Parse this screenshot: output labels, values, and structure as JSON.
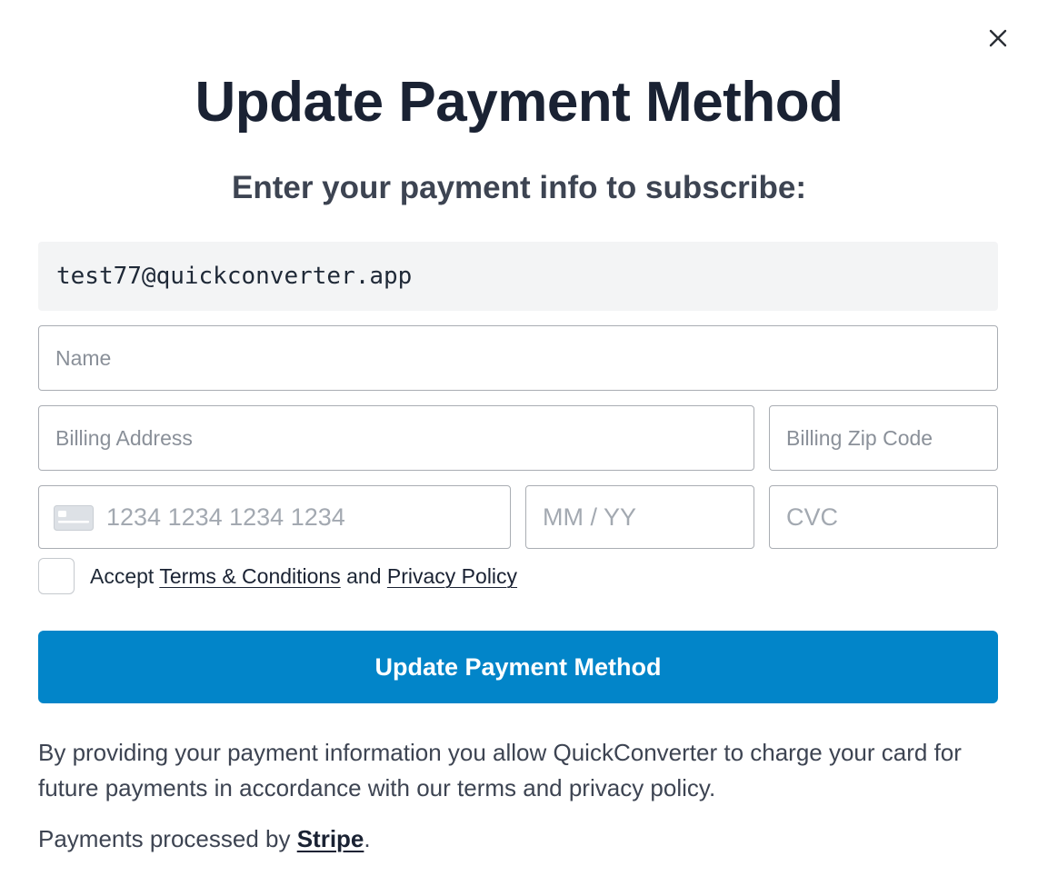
{
  "dialog": {
    "title": "Update Payment Method",
    "subtitle": "Enter your payment info to subscribe:",
    "close_icon": "close-icon"
  },
  "form": {
    "email": "test77@quickconverter.app",
    "name_placeholder": "Name",
    "billing_address_placeholder": "Billing Address",
    "billing_zip_placeholder": "Billing Zip Code",
    "card_number_placeholder": "1234 1234 1234 1234",
    "card_icon": "credit-card-icon",
    "expiry_placeholder": "MM / YY",
    "cvc_placeholder": "CVC",
    "terms_checked": false
  },
  "terms": {
    "prefix": "Accept",
    "terms_link": "Terms & Conditions",
    "conjunction": "and",
    "privacy_link": "Privacy Policy"
  },
  "submit_label": "Update Payment Method",
  "disclaimer": "By providing your payment information you allow QuickConverter to charge your card for future payments in accordance with our terms and privacy policy.",
  "processed": {
    "prefix": "Payments processed by",
    "link": "Stripe",
    "suffix": "."
  },
  "colors": {
    "accent": "#0285c9",
    "title": "#1a2233",
    "body_text": "#3d4452",
    "field_border": "#a9adb3",
    "email_bg": "#f3f4f5"
  }
}
